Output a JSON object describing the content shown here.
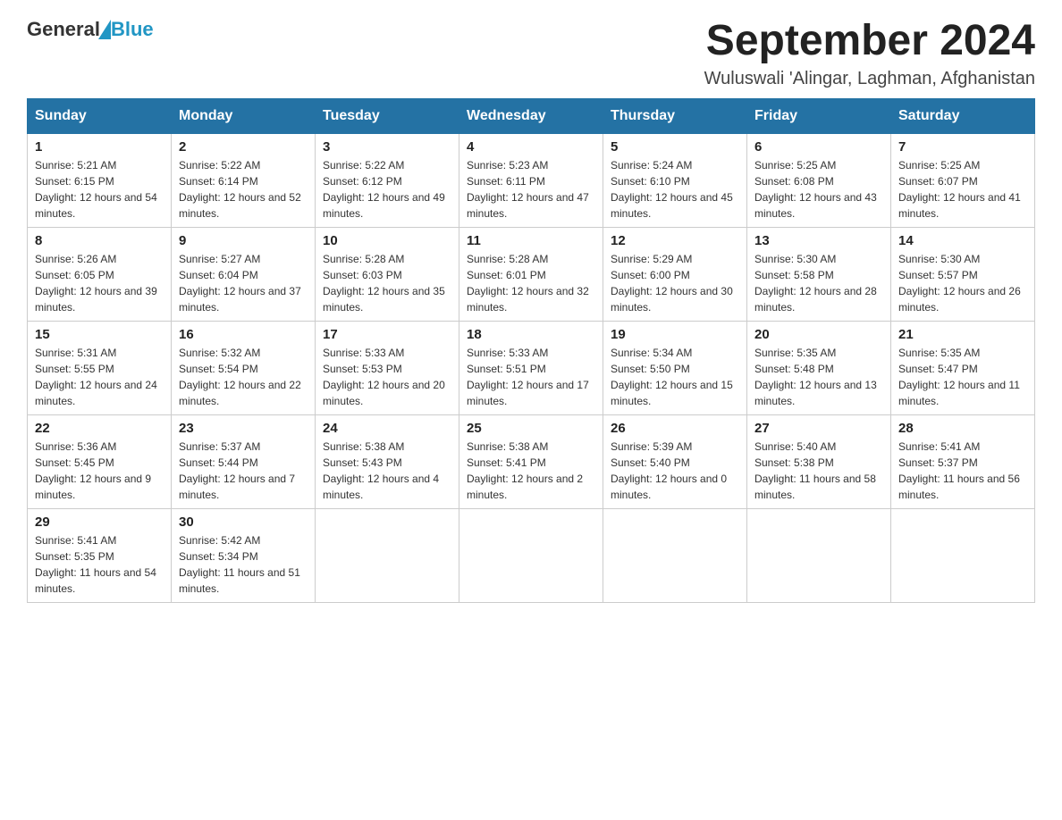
{
  "logo": {
    "general": "General",
    "blue": "Blue"
  },
  "title": "September 2024",
  "location": "Wuluswali 'Alingar, Laghman, Afghanistan",
  "weekdays": [
    "Sunday",
    "Monday",
    "Tuesday",
    "Wednesday",
    "Thursday",
    "Friday",
    "Saturday"
  ],
  "weeks": [
    [
      {
        "day": "1",
        "sunrise": "5:21 AM",
        "sunset": "6:15 PM",
        "daylight": "12 hours and 54 minutes."
      },
      {
        "day": "2",
        "sunrise": "5:22 AM",
        "sunset": "6:14 PM",
        "daylight": "12 hours and 52 minutes."
      },
      {
        "day": "3",
        "sunrise": "5:22 AM",
        "sunset": "6:12 PM",
        "daylight": "12 hours and 49 minutes."
      },
      {
        "day": "4",
        "sunrise": "5:23 AM",
        "sunset": "6:11 PM",
        "daylight": "12 hours and 47 minutes."
      },
      {
        "day": "5",
        "sunrise": "5:24 AM",
        "sunset": "6:10 PM",
        "daylight": "12 hours and 45 minutes."
      },
      {
        "day": "6",
        "sunrise": "5:25 AM",
        "sunset": "6:08 PM",
        "daylight": "12 hours and 43 minutes."
      },
      {
        "day": "7",
        "sunrise": "5:25 AM",
        "sunset": "6:07 PM",
        "daylight": "12 hours and 41 minutes."
      }
    ],
    [
      {
        "day": "8",
        "sunrise": "5:26 AM",
        "sunset": "6:05 PM",
        "daylight": "12 hours and 39 minutes."
      },
      {
        "day": "9",
        "sunrise": "5:27 AM",
        "sunset": "6:04 PM",
        "daylight": "12 hours and 37 minutes."
      },
      {
        "day": "10",
        "sunrise": "5:28 AM",
        "sunset": "6:03 PM",
        "daylight": "12 hours and 35 minutes."
      },
      {
        "day": "11",
        "sunrise": "5:28 AM",
        "sunset": "6:01 PM",
        "daylight": "12 hours and 32 minutes."
      },
      {
        "day": "12",
        "sunrise": "5:29 AM",
        "sunset": "6:00 PM",
        "daylight": "12 hours and 30 minutes."
      },
      {
        "day": "13",
        "sunrise": "5:30 AM",
        "sunset": "5:58 PM",
        "daylight": "12 hours and 28 minutes."
      },
      {
        "day": "14",
        "sunrise": "5:30 AM",
        "sunset": "5:57 PM",
        "daylight": "12 hours and 26 minutes."
      }
    ],
    [
      {
        "day": "15",
        "sunrise": "5:31 AM",
        "sunset": "5:55 PM",
        "daylight": "12 hours and 24 minutes."
      },
      {
        "day": "16",
        "sunrise": "5:32 AM",
        "sunset": "5:54 PM",
        "daylight": "12 hours and 22 minutes."
      },
      {
        "day": "17",
        "sunrise": "5:33 AM",
        "sunset": "5:53 PM",
        "daylight": "12 hours and 20 minutes."
      },
      {
        "day": "18",
        "sunrise": "5:33 AM",
        "sunset": "5:51 PM",
        "daylight": "12 hours and 17 minutes."
      },
      {
        "day": "19",
        "sunrise": "5:34 AM",
        "sunset": "5:50 PM",
        "daylight": "12 hours and 15 minutes."
      },
      {
        "day": "20",
        "sunrise": "5:35 AM",
        "sunset": "5:48 PM",
        "daylight": "12 hours and 13 minutes."
      },
      {
        "day": "21",
        "sunrise": "5:35 AM",
        "sunset": "5:47 PM",
        "daylight": "12 hours and 11 minutes."
      }
    ],
    [
      {
        "day": "22",
        "sunrise": "5:36 AM",
        "sunset": "5:45 PM",
        "daylight": "12 hours and 9 minutes."
      },
      {
        "day": "23",
        "sunrise": "5:37 AM",
        "sunset": "5:44 PM",
        "daylight": "12 hours and 7 minutes."
      },
      {
        "day": "24",
        "sunrise": "5:38 AM",
        "sunset": "5:43 PM",
        "daylight": "12 hours and 4 minutes."
      },
      {
        "day": "25",
        "sunrise": "5:38 AM",
        "sunset": "5:41 PM",
        "daylight": "12 hours and 2 minutes."
      },
      {
        "day": "26",
        "sunrise": "5:39 AM",
        "sunset": "5:40 PM",
        "daylight": "12 hours and 0 minutes."
      },
      {
        "day": "27",
        "sunrise": "5:40 AM",
        "sunset": "5:38 PM",
        "daylight": "11 hours and 58 minutes."
      },
      {
        "day": "28",
        "sunrise": "5:41 AM",
        "sunset": "5:37 PM",
        "daylight": "11 hours and 56 minutes."
      }
    ],
    [
      {
        "day": "29",
        "sunrise": "5:41 AM",
        "sunset": "5:35 PM",
        "daylight": "11 hours and 54 minutes."
      },
      {
        "day": "30",
        "sunrise": "5:42 AM",
        "sunset": "5:34 PM",
        "daylight": "11 hours and 51 minutes."
      },
      null,
      null,
      null,
      null,
      null
    ]
  ],
  "labels": {
    "sunrise_prefix": "Sunrise: ",
    "sunset_prefix": "Sunset: ",
    "daylight_prefix": "Daylight: "
  }
}
